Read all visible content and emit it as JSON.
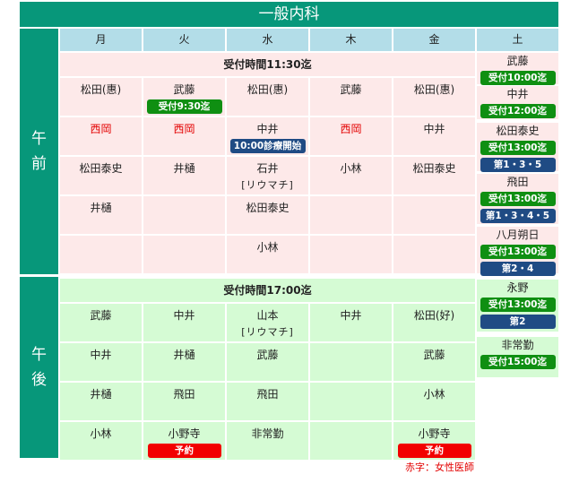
{
  "title": "一般内科",
  "days": [
    "月",
    "火",
    "水",
    "木",
    "金",
    "土"
  ],
  "am": {
    "label_chars": [
      "午",
      "前"
    ],
    "reception": "受付時間11:30迄",
    "rows": [
      [
        {
          "name": "松田(惠)"
        },
        {
          "name": "武藤",
          "badge": "受付9:30迄",
          "badge_color": "green"
        },
        {
          "name": "松田(惠)"
        },
        {
          "name": "武藤"
        },
        {
          "name": "松田(惠)"
        }
      ],
      [
        {
          "name": "西岡",
          "red": true
        },
        {
          "name": "西岡",
          "red": true
        },
        {
          "name": "中井",
          "badge": "10:00診療開始",
          "badge_color": "blue"
        },
        {
          "name": "西岡",
          "red": true
        },
        {
          "name": "中井"
        }
      ],
      [
        {
          "name": "松田泰史"
        },
        {
          "name": "井樋"
        },
        {
          "name": "石井",
          "sub": "[リウマチ]"
        },
        {
          "name": "小林"
        },
        {
          "name": "松田泰史"
        }
      ],
      [
        {
          "name": "井樋"
        },
        {
          "name": ""
        },
        {
          "name": "松田泰史"
        },
        {
          "name": ""
        },
        {
          "name": ""
        }
      ],
      [
        {
          "name": ""
        },
        {
          "name": ""
        },
        {
          "name": "小林"
        },
        {
          "name": ""
        },
        {
          "name": ""
        }
      ]
    ],
    "saturday": [
      {
        "name": "武藤",
        "badges": [
          {
            "text": "受付10:00迄",
            "color": "green"
          }
        ]
      },
      {
        "name": "中井",
        "badges": [
          {
            "text": "受付12:00迄",
            "color": "green"
          }
        ]
      },
      {
        "name": "松田泰史",
        "badges": [
          {
            "text": "受付13:00迄",
            "color": "green"
          },
          {
            "text": "第1・3・5",
            "color": "blue"
          }
        ]
      },
      {
        "name": "飛田",
        "badges": [
          {
            "text": "受付13:00迄",
            "color": "green"
          },
          {
            "text": "第1・3・4・5",
            "color": "blue"
          }
        ]
      },
      {
        "name": "八月朔日",
        "badges": [
          {
            "text": "受付13:00迄",
            "color": "green"
          },
          {
            "text": "第2・4",
            "color": "blue"
          }
        ]
      }
    ]
  },
  "pm": {
    "label_chars": [
      "午",
      "後"
    ],
    "reception": "受付時間17:00迄",
    "rows": [
      [
        {
          "name": "武藤"
        },
        {
          "name": "中井"
        },
        {
          "name": "山本",
          "sub": "[リウマチ]"
        },
        {
          "name": "中井"
        },
        {
          "name": "松田(好)"
        }
      ],
      [
        {
          "name": "中井"
        },
        {
          "name": "井樋"
        },
        {
          "name": "武藤"
        },
        {
          "name": ""
        },
        {
          "name": "武藤"
        }
      ],
      [
        {
          "name": "井樋"
        },
        {
          "name": "飛田"
        },
        {
          "name": "飛田"
        },
        {
          "name": ""
        },
        {
          "name": "小林"
        }
      ],
      [
        {
          "name": "小林"
        },
        {
          "name": "小野寺",
          "badge": "予約",
          "badge_color": "red"
        },
        {
          "name": "非常勤"
        },
        {
          "name": ""
        },
        {
          "name": "小野寺",
          "badge": "予約",
          "badge_color": "red"
        }
      ]
    ],
    "saturday": [
      {
        "name": "永野",
        "badges": [
          {
            "text": "受付13:00迄",
            "color": "green"
          },
          {
            "text": "第2",
            "color": "blue"
          }
        ]
      },
      {
        "name": "非常勤",
        "badges": [
          {
            "text": "受付15:00迄",
            "color": "green"
          }
        ]
      }
    ]
  },
  "note": "赤字：女性医師",
  "colors": {
    "header": "#07977a",
    "day_header": "#b3dde8",
    "am_bg": "#fde9e9",
    "pm_bg": "#d5fbd4",
    "green": "#0f8f12",
    "blue": "#1f4b84",
    "red": "#f20000",
    "red_text": "#e30000"
  }
}
